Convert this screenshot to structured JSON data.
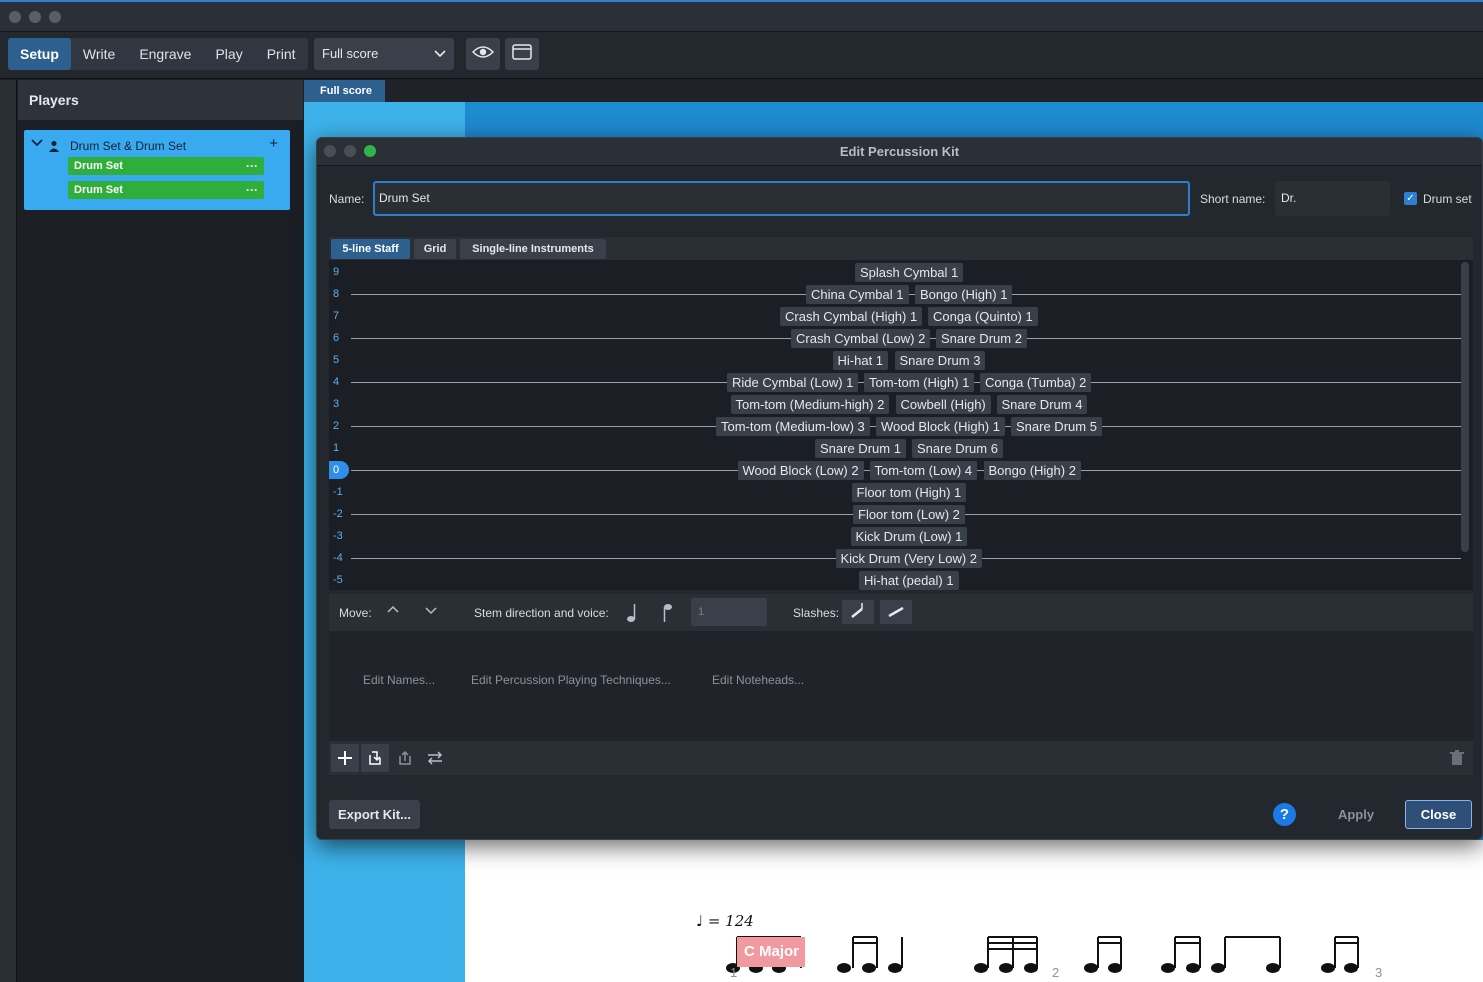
{
  "app": {
    "modes": [
      "Setup",
      "Write",
      "Engrave",
      "Play",
      "Print"
    ],
    "active_mode": "Setup",
    "layout_select": "Full score"
  },
  "players_panel": {
    "title": "Players",
    "player_name": "Drum Set & Drum Set",
    "instruments": [
      "Drum Set",
      "Drum Set"
    ]
  },
  "score": {
    "tab": "Full score",
    "tempo": "♩ = 124",
    "key_signature": "C Major",
    "bar_numbers": [
      "1",
      "2",
      "3"
    ]
  },
  "dialog": {
    "title": "Edit Percussion Kit",
    "name_label": "Name:",
    "name_value": "Drum Set",
    "short_name_label": "Short name:",
    "short_name_value": "Dr.",
    "drum_set_checkbox": "Drum set",
    "drum_set_checked": true,
    "view_tabs": [
      "5-line Staff",
      "Grid",
      "Single-line Instruments"
    ],
    "active_view_tab": "5-line Staff",
    "selected_position": "0",
    "staff_rows": [
      {
        "pos": "9",
        "instruments": [
          "Splash Cymbal 1"
        ]
      },
      {
        "pos": "8",
        "instruments": [
          "China Cymbal 1",
          "Bongo (High) 1"
        ]
      },
      {
        "pos": "7",
        "instruments": [
          "Crash Cymbal (High) 1",
          "Conga (Quinto) 1"
        ]
      },
      {
        "pos": "6",
        "instruments": [
          "Crash Cymbal (Low) 2",
          "Snare Drum 2"
        ]
      },
      {
        "pos": "5",
        "instruments": [
          "Hi-hat 1",
          "Snare Drum 3"
        ]
      },
      {
        "pos": "4",
        "instruments": [
          "Ride Cymbal (Low) 1",
          "Tom-tom (High) 1",
          "Conga (Tumba) 2"
        ]
      },
      {
        "pos": "3",
        "instruments": [
          "Tom-tom (Medium-high) 2",
          "Cowbell (High)",
          "Snare Drum 4"
        ]
      },
      {
        "pos": "2",
        "instruments": [
          "Tom-tom (Medium-low) 3",
          "Wood Block (High) 1",
          "Snare Drum 5"
        ]
      },
      {
        "pos": "1",
        "instruments": [
          "Snare Drum 1",
          "Snare Drum 6"
        ]
      },
      {
        "pos": "0",
        "instruments": [
          "Wood Block (Low) 2",
          "Tom-tom (Low) 4",
          "Bongo (High) 2"
        ]
      },
      {
        "pos": "-1",
        "instruments": [
          "Floor tom (High) 1"
        ]
      },
      {
        "pos": "-2",
        "instruments": [
          "Floor tom (Low) 2"
        ]
      },
      {
        "pos": "-3",
        "instruments": [
          "Kick Drum (Low) 1"
        ]
      },
      {
        "pos": "-4",
        "instruments": [
          "Kick Drum (Very Low) 2"
        ]
      },
      {
        "pos": "-5",
        "instruments": [
          "Hi-hat (pedal) 1"
        ]
      }
    ],
    "move_label": "Move:",
    "stem_label": "Stem direction and voice:",
    "voice_value": "1",
    "slashes_label": "Slashes:",
    "links": [
      "Edit Names...",
      "Edit Percussion Playing Techniques...",
      "Edit Noteheads..."
    ],
    "export_button": "Export Kit...",
    "help_button": "?",
    "apply_button": "Apply",
    "close_button": "Close"
  }
}
